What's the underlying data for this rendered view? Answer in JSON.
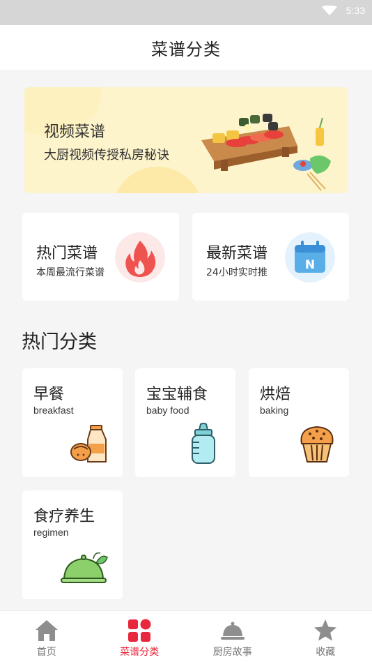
{
  "status_bar": {
    "time": "5:33"
  },
  "header": {
    "title": "菜谱分类"
  },
  "banner": {
    "title": "视频菜谱",
    "subtitle": "大厨视频传授私房秘诀"
  },
  "quick_cards": [
    {
      "title": "热门菜谱",
      "subtitle": "本周最流行菜谱",
      "icon": "flame-icon"
    },
    {
      "title": "最新菜谱",
      "subtitle": "24小时实时推",
      "icon": "calendar-new-icon"
    }
  ],
  "section": {
    "title": "热门分类"
  },
  "categories": [
    {
      "title": "早餐",
      "subtitle": "breakfast",
      "icon": "milk-bread-icon"
    },
    {
      "title": "宝宝辅食",
      "subtitle": "baby food",
      "icon": "baby-bottle-icon"
    },
    {
      "title": "烘焙",
      "subtitle": "baking",
      "icon": "muffin-icon"
    },
    {
      "title": "食疗养生",
      "subtitle": "regimen",
      "icon": "covered-dish-icon"
    }
  ],
  "tabs": [
    {
      "label": "首页",
      "icon": "home-icon",
      "active": false
    },
    {
      "label": "菜谱分类",
      "icon": "grid-icon",
      "active": true
    },
    {
      "label": "厨房故事",
      "icon": "cloche-icon",
      "active": false
    },
    {
      "label": "收藏",
      "icon": "star-icon",
      "active": false
    }
  ],
  "colors": {
    "accent": "#e8283c",
    "inactive": "#777777",
    "banner_bg": "#fdf4cc",
    "page_bg": "#f5f5f5"
  }
}
